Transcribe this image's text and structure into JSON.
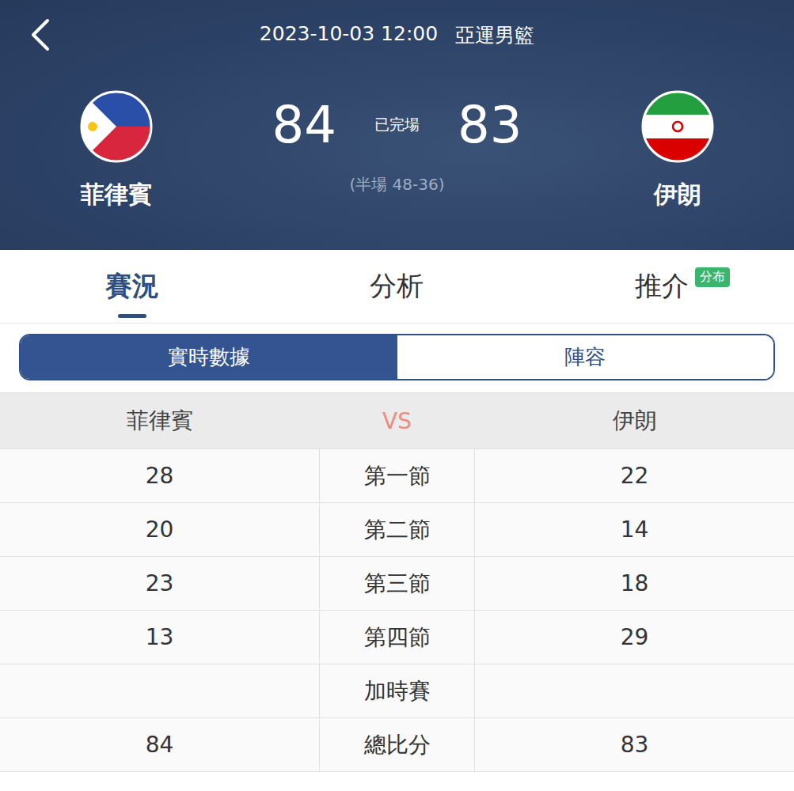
{
  "match": {
    "datetime": "2023-10-03 12:00",
    "competition": "亞運男籃",
    "status": "已完場",
    "halftime": "(半場 48-36)"
  },
  "home": {
    "name": "菲律賓",
    "score": "84"
  },
  "away": {
    "name": "伊朗",
    "score": "83"
  },
  "tabs": [
    {
      "label": "賽況",
      "selected": true,
      "badge": ""
    },
    {
      "label": "分析",
      "selected": false,
      "badge": ""
    },
    {
      "label": "推介",
      "selected": false,
      "badge": "分布"
    }
  ],
  "segments": [
    {
      "label": "實時數據",
      "selected": true
    },
    {
      "label": "陣容",
      "selected": false
    }
  ],
  "table": {
    "columns": [
      "菲律賓",
      "VS",
      "伊朗"
    ],
    "rows": [
      {
        "home": "28",
        "label": "第一節",
        "away": "22"
      },
      {
        "home": "20",
        "label": "第二節",
        "away": "14"
      },
      {
        "home": "23",
        "label": "第三節",
        "away": "18"
      },
      {
        "home": "13",
        "label": "第四節",
        "away": "29"
      },
      {
        "home": "",
        "label": "加時賽",
        "away": ""
      },
      {
        "home": "84",
        "label": "總比分",
        "away": "83"
      }
    ]
  }
}
